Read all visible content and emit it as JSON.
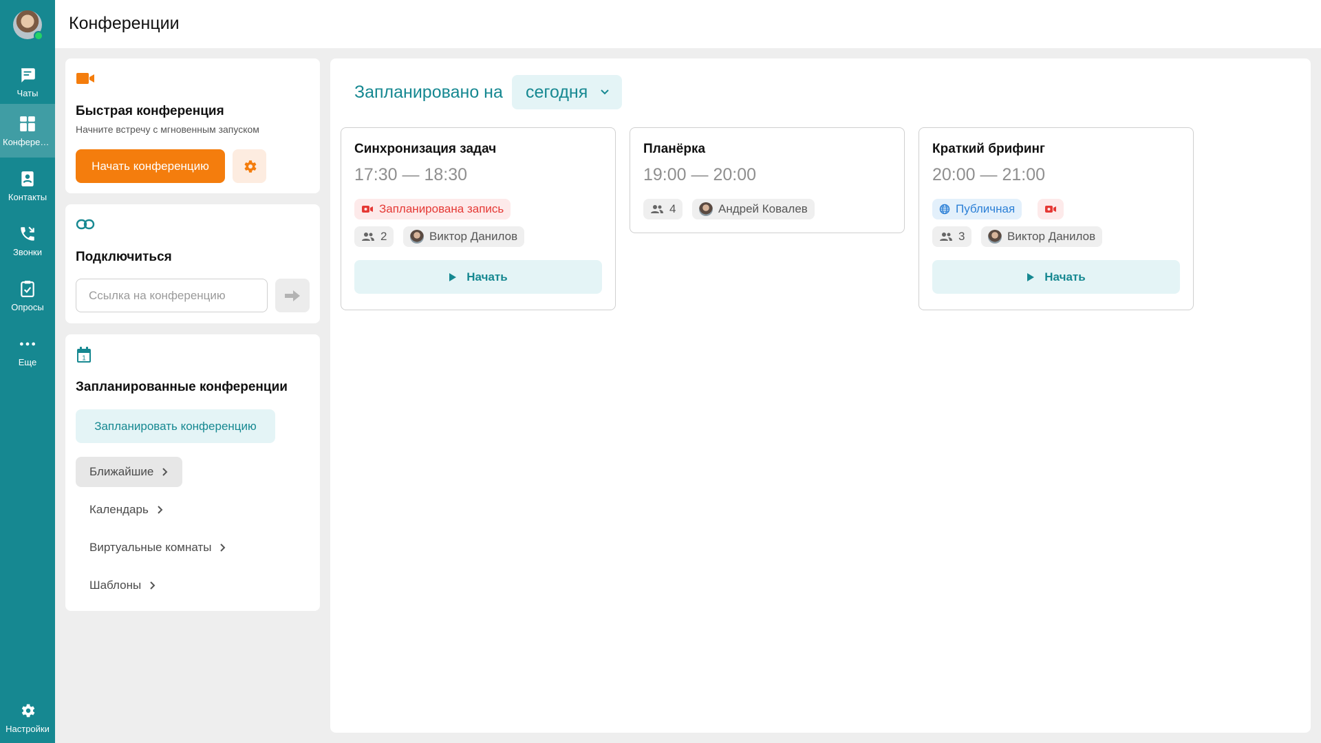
{
  "sidebar": {
    "items": [
      {
        "label": "Чаты",
        "icon": "chat-icon"
      },
      {
        "label": "Конференции",
        "icon": "conference-icon"
      },
      {
        "label": "Контакты",
        "icon": "contacts-icon"
      },
      {
        "label": "Звонки",
        "icon": "calls-icon"
      },
      {
        "label": "Опросы",
        "icon": "polls-icon"
      },
      {
        "label": "Еще",
        "icon": "more-icon"
      }
    ],
    "settings_label": "Настройки",
    "accent": "#168891"
  },
  "header": {
    "title": "Конференции"
  },
  "quick": {
    "title": "Быстрая конференция",
    "subtitle": "Начните встречу с мгновенным запуском",
    "start_label": "Начать конференцию",
    "accent": "#f47d0d"
  },
  "connect": {
    "title": "Подключиться",
    "placeholder": "Ссылка на конференцию"
  },
  "planned": {
    "title": "Запланированные конференции",
    "plan_button": "Запланировать конференцию",
    "menu": [
      "Ближайшие",
      "Календарь",
      "Виртуальные комнаты",
      "Шаблоны"
    ]
  },
  "schedule": {
    "label": "Запланировано на",
    "day": "сегодня"
  },
  "cards": [
    {
      "title": "Синхронизация задач",
      "time": "17:30 — 18:30",
      "recording_label": "Запланирована запись",
      "participants": "2",
      "organizer": "Виктор Данилов",
      "start_label": "Начать"
    },
    {
      "title": "Планёрка",
      "time": "19:00 — 20:00",
      "participants": "4",
      "organizer": "Андрей Ковалев"
    },
    {
      "title": "Краткий брифинг",
      "time": "20:00 — 21:00",
      "public_label": "Публичная",
      "participants": "3",
      "organizer": "Виктор Данилов",
      "start_label": "Начать"
    }
  ]
}
